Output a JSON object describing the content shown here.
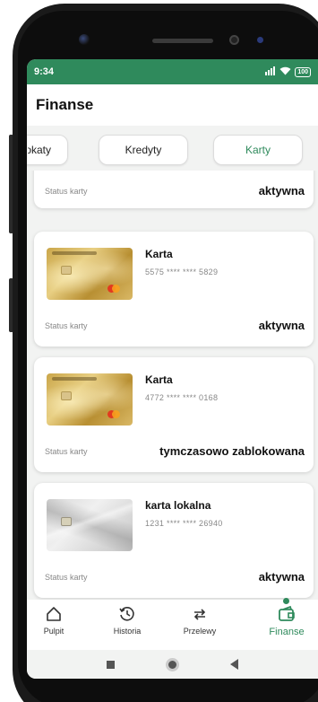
{
  "status_bar": {
    "time": "9:34",
    "battery": "100"
  },
  "header": {
    "title": "Finanse"
  },
  "tabs": [
    {
      "label": "Lokaty",
      "active": false
    },
    {
      "label": "Kredyty",
      "active": false
    },
    {
      "label": "Karty",
      "active": true
    }
  ],
  "cards": [
    {
      "status_label": "Status karty",
      "status": "aktywna"
    },
    {
      "name": "Karta",
      "number": "5575 **** **** 5829",
      "image": "gold-card-image",
      "status_label": "Status karty",
      "status": "aktywna"
    },
    {
      "name": "Karta",
      "number": "4772 **** **** 0168",
      "image": "gold-card-image",
      "status_label": "Status karty",
      "status": "tymczasowo zablokowana"
    },
    {
      "name": "karta lokalna",
      "number": "1231 **** **** 26940",
      "image": "silver-card-image",
      "status_label": "Status karty",
      "status": "aktywna"
    }
  ],
  "bottom_nav": [
    {
      "label": "Pulpit",
      "icon": "home-icon",
      "active": false
    },
    {
      "label": "Historia",
      "icon": "history-icon",
      "active": false
    },
    {
      "label": "Przelewy",
      "icon": "transfer-icon",
      "active": false
    },
    {
      "label": "Finanse",
      "icon": "finance-icon",
      "active": true
    }
  ],
  "colors": {
    "accent": "#2f8a5c",
    "background": "#f2f3f2"
  }
}
